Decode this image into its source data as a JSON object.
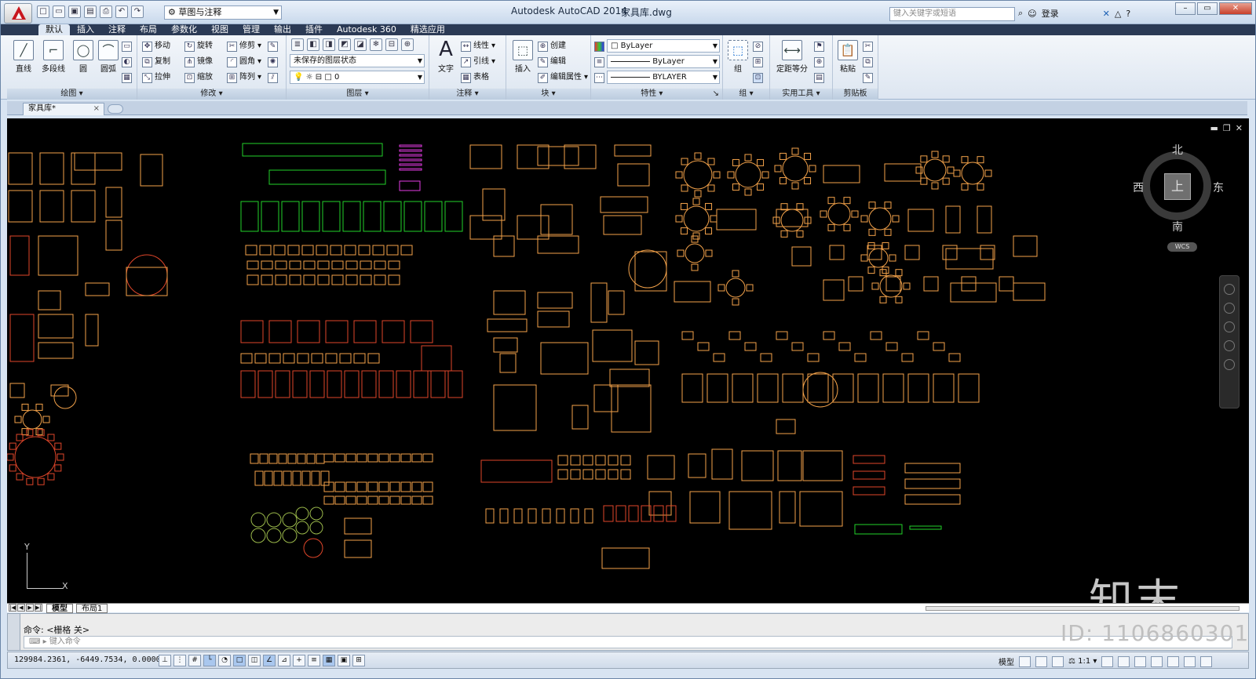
{
  "titlebar": {
    "app_title": "Autodesk AutoCAD 2014",
    "file_name": "家具库.dwg",
    "workspace": "草图与注释",
    "search_placeholder": "键入关键字或短语",
    "login": "登录"
  },
  "ribbon": {
    "tabs": [
      "默认",
      "插入",
      "注释",
      "布局",
      "参数化",
      "视图",
      "管理",
      "输出",
      "插件",
      "Autodesk 360",
      "精选应用"
    ],
    "active_tab": "默认",
    "panels": {
      "draw": {
        "title": "绘图",
        "line": "直线",
        "polyline": "多段线",
        "circle": "圆",
        "arc": "圆弧"
      },
      "modify": {
        "title": "修改",
        "move": "移动",
        "rotate": "旋转",
        "trim": "修剪",
        "copy": "复制",
        "mirror": "镜像",
        "fillet": "圆角",
        "stretch": "拉伸",
        "scale": "缩放",
        "array": "阵列"
      },
      "layers": {
        "title": "图层",
        "layer_state": "未保存的图层状态",
        "current_layer": "0"
      },
      "annotation": {
        "title": "注释",
        "text": "文字",
        "linear": "线性",
        "leader": "引线",
        "table": "表格"
      },
      "block": {
        "title": "块",
        "insert": "插入",
        "create": "创建",
        "edit": "编辑",
        "edit_attributes": "编辑属性"
      },
      "properties": {
        "title": "特性",
        "color": "ByLayer",
        "linetype": "ByLayer",
        "lineweight": "BYLAYER"
      },
      "groups": {
        "title": "组",
        "group": "组"
      },
      "utilities": {
        "title": "实用工具",
        "measure": "定距等分"
      },
      "clipboard": {
        "title": "剪贴板",
        "paste": "粘贴"
      }
    }
  },
  "doc_tab": {
    "name": "家具库*"
  },
  "viewcube": {
    "north": "北",
    "south": "南",
    "east": "东",
    "west": "西",
    "top": "上",
    "wcs": "WCS"
  },
  "ucs": {
    "x": "X",
    "y": "Y"
  },
  "layout_tabs": {
    "model": "模型",
    "layout1": "布局1"
  },
  "command": {
    "history": "命令:  <栅格 关>",
    "input_placeholder": "键入命令"
  },
  "status": {
    "coordinates": "129984.2361, -6449.7534, 0.0000",
    "model_label": "模型",
    "annotation_scale": "1:1"
  },
  "watermark": {
    "logo": "知末",
    "id": "ID: 1106860301"
  },
  "colors": {
    "canvas": "#000000",
    "cad_green": "#22d22a",
    "cad_orange": "#f3a24a",
    "cad_red": "#e0462a",
    "cad_magenta": "#e43ce4",
    "cad_olive": "#9ab84a",
    "ribbon_dark": "#2b3a55"
  }
}
